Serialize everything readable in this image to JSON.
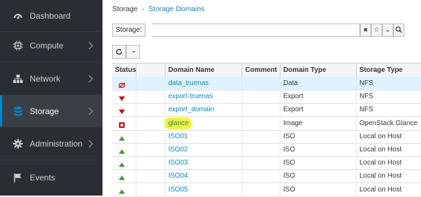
{
  "nav": {
    "items": [
      {
        "label": "Dashboard",
        "icon": "dashboard-icon",
        "chevron": false,
        "active": false
      },
      {
        "label": "Compute",
        "icon": "cpu-icon",
        "chevron": true,
        "active": false
      },
      {
        "label": "Network",
        "icon": "network-icon",
        "chevron": true,
        "active": false
      },
      {
        "label": "Storage",
        "icon": "database-icon",
        "chevron": true,
        "active": true
      },
      {
        "label": "Administration",
        "icon": "gear-icon",
        "chevron": true,
        "active": false
      },
      {
        "label": "Events",
        "icon": "flag-icon",
        "chevron": false,
        "active": false
      }
    ]
  },
  "breadcrumb": {
    "root": "Storage",
    "separator": "›",
    "current": "Storage Domains"
  },
  "search": {
    "label": "Storage:",
    "value": "",
    "clear_glyph": "✖",
    "star_glyph": "☆",
    "caret_glyph": "⌄",
    "search_glyph": "🔍"
  },
  "toolbar": {
    "refresh_glyph": "↻",
    "caret_glyph": "⌄"
  },
  "table": {
    "columns": [
      "Status",
      "",
      "Domain Name",
      "Comment",
      "Domain Type",
      "Storage Type"
    ],
    "rows": [
      {
        "status": "unattached",
        "name": "data_truenas",
        "comment": "",
        "domain_type": "Data",
        "storage_type": "NFS",
        "selected": true
      },
      {
        "status": "down",
        "name": "export-truenas",
        "comment": "",
        "domain_type": "Export",
        "storage_type": "NFS",
        "selected": false
      },
      {
        "status": "down",
        "name": "export_domain",
        "comment": "",
        "domain_type": "Export",
        "storage_type": "NFS",
        "selected": false
      },
      {
        "status": "error",
        "name": "glance",
        "comment": "",
        "domain_type": "Image",
        "storage_type": "OpenStack Glance",
        "selected": false
      },
      {
        "status": "up",
        "name": "ISO01",
        "comment": "",
        "domain_type": "ISO",
        "storage_type": "Local on Host",
        "selected": false
      },
      {
        "status": "up",
        "name": "ISO02",
        "comment": "",
        "domain_type": "ISO",
        "storage_type": "Local on Host",
        "selected": false
      },
      {
        "status": "up",
        "name": "ISO03",
        "comment": "",
        "domain_type": "ISO",
        "storage_type": "Local on Host",
        "selected": false
      },
      {
        "status": "up",
        "name": "ISO04",
        "comment": "",
        "domain_type": "ISO",
        "storage_type": "Local on Host",
        "selected": false
      },
      {
        "status": "up",
        "name": "ISO05",
        "comment": "",
        "domain_type": "ISO",
        "storage_type": "Local on Host",
        "selected": false
      }
    ]
  },
  "colors": {
    "sidebar": "#292e34",
    "accent": "#0088ce",
    "up": "#3f9c35",
    "down": "#cc0000",
    "highlight": "#f3f500"
  }
}
